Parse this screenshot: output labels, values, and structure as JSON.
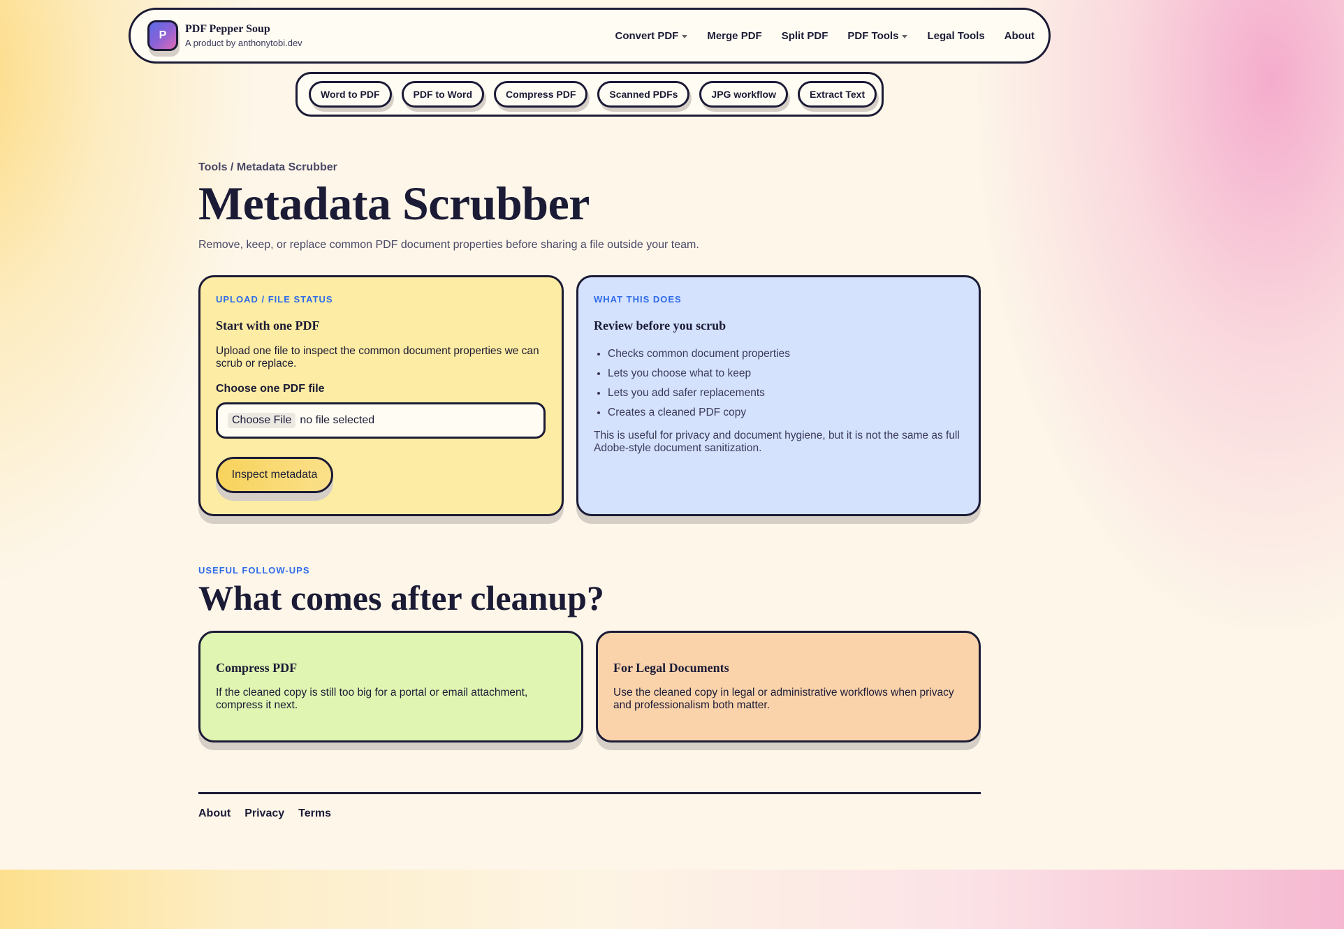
{
  "header": {
    "logo_letter": "P",
    "brand_title": "PDF Pepper Soup",
    "brand_sub": "A product by anthonytobi.dev",
    "nav": [
      {
        "label": "Convert PDF",
        "dropdown": true
      },
      {
        "label": "Merge PDF",
        "dropdown": false
      },
      {
        "label": "Split PDF",
        "dropdown": false
      },
      {
        "label": "PDF Tools",
        "dropdown": true
      },
      {
        "label": "Legal Tools",
        "dropdown": false
      },
      {
        "label": "About",
        "dropdown": false
      }
    ]
  },
  "tool_pills": [
    "Word to PDF",
    "PDF to Word",
    "Compress PDF",
    "Scanned PDFs",
    "JPG workflow",
    "Extract Text"
  ],
  "hero": {
    "breadcrumb": "Tools / Metadata Scrubber",
    "title": "Metadata Scrubber",
    "subtitle": "Remove, keep, or replace common PDF document properties before sharing a file outside your team."
  },
  "upload_card": {
    "eyebrow": "UPLOAD / FILE STATUS",
    "heading": "Start with one PDF",
    "body": "Upload one file to inspect the common document properties we can scrub or replace.",
    "field_label": "Choose one PDF file",
    "file_button": "Choose File",
    "file_status": "no file selected",
    "action_label": "Inspect metadata"
  },
  "info_card": {
    "eyebrow": "WHAT THIS DOES",
    "heading": "Review before you scrub",
    "bullets": [
      "Checks common document properties",
      "Lets you choose what to keep",
      "Lets you add safer replacements",
      "Creates a cleaned PDF copy"
    ],
    "note": "This is useful for privacy and document hygiene, but it is not the same as full Adobe-style document sanitization."
  },
  "followups": {
    "eyebrow": "USEFUL FOLLOW-UPS",
    "heading": "What comes after cleanup?",
    "cards": [
      {
        "title": "Compress PDF",
        "body": "If the cleaned copy is still too big for a portal or email attachment, compress it next."
      },
      {
        "title": "For Legal Documents",
        "body": "Use the cleaned copy in legal or administrative workflows when privacy and professionalism both matter."
      }
    ]
  },
  "footer": {
    "links": [
      "About",
      "Privacy",
      "Terms"
    ]
  },
  "colors": {
    "ink": "#1c1b36",
    "accent_blue": "#2f6be8",
    "upload_card_bg": "#fdeca3",
    "info_card_bg": "#d4e2fe",
    "compress_card_bg": "#dff5b1",
    "legal_card_bg": "#fbd3ab",
    "button_yellow": "#f7d35c"
  }
}
